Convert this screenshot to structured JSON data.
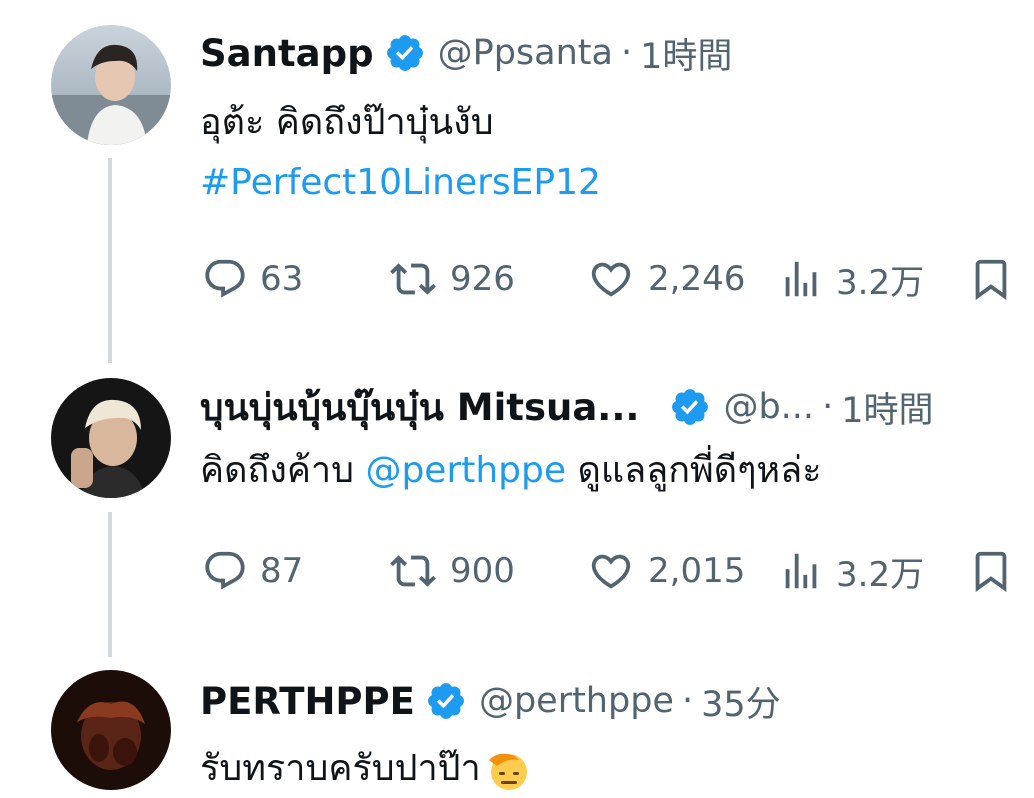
{
  "tweets": [
    {
      "name": "Santapp",
      "handle": "@Ppsanta",
      "separator": "·",
      "time": "1時間",
      "text_lines": [
        "อุต้ะ คิดถึงป๊าบุ๋นงับ"
      ],
      "hashtag": "#Perfect10LinersEP12",
      "replies": "63",
      "retweets": "926",
      "likes": "2,246",
      "views": "3.2万"
    },
    {
      "name": "บุนบุ่นบุ้นบุ๊นบุ๋น Mitsua...",
      "handle": "@b...",
      "separator": "·",
      "time": "1時間",
      "text_before": "คิดถึงค้าบ",
      "mention": "@perthppe",
      "text_after": "ดูแลลูกพี่ดีๆหล่ะ",
      "replies": "87",
      "retweets": "900",
      "likes": "2,015",
      "views": "3.2万"
    },
    {
      "name": "PERTHPPE",
      "handle": "@perthppe",
      "separator": "·",
      "time": "35分",
      "text": "รับทราบครับปาป๊า",
      "emoji": "saluting-face-icon"
    }
  ],
  "colors": {
    "text": "#0f1419",
    "secondary": "#536471",
    "link": "#1d9bf0",
    "verified": "#1d9bf0",
    "thread_line": "#cfd9de"
  },
  "icons": [
    "reply-icon",
    "retweet-icon",
    "like-icon",
    "views-icon",
    "bookmark-icon",
    "verified-badge-icon"
  ]
}
